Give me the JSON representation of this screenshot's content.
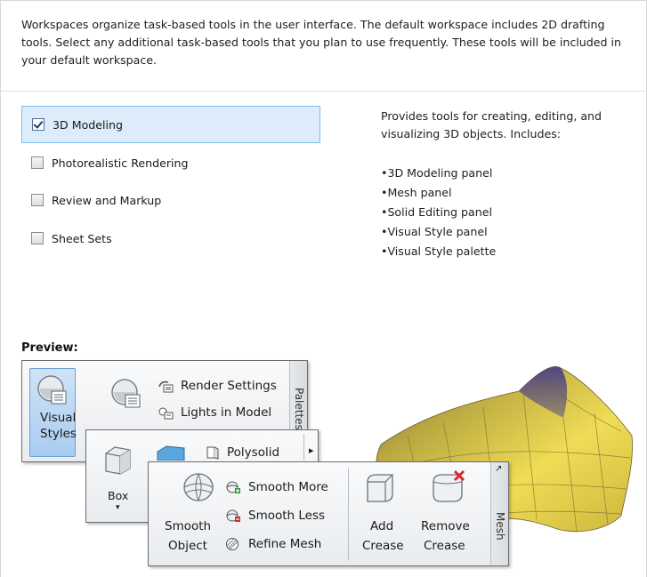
{
  "intro_text": "Workspaces organize task-based tools in the user interface. The default workspace includes 2D drafting tools. Select any additional task-based tools that you plan to use frequently. These tools will be included in your default workspace.",
  "options": [
    {
      "label": "3D Modeling",
      "checked": true
    },
    {
      "label": "Photorealistic Rendering",
      "checked": false
    },
    {
      "label": "Review and Markup",
      "checked": false
    },
    {
      "label": "Sheet Sets",
      "checked": false
    }
  ],
  "description": {
    "text": "Provides tools for creating, editing, and visualizing 3D objects. Includes:",
    "items": [
      "3D Modeling panel",
      "Mesh panel",
      "Solid Editing panel",
      "Visual Style panel",
      "Visual Style palette"
    ]
  },
  "preview": {
    "label": "Preview:",
    "palettes_panel": {
      "visual_styles_line1": "Visual",
      "visual_styles_line2": "Styles",
      "render_settings": "Render Settings",
      "lights_in_model": "Lights in Model",
      "title": "Palettes"
    },
    "modeling_panel": {
      "box": "Box",
      "box_arrow": "▾",
      "polysolid": "Polysolid",
      "expand": "▸"
    },
    "mesh_panel": {
      "smooth_object_line1": "Smooth",
      "smooth_object_line2": "Object",
      "smooth_more": "Smooth More",
      "smooth_less": "Smooth Less",
      "refine_mesh": "Refine Mesh",
      "add_crease_line1": "Add",
      "add_crease_line2": "Crease",
      "remove_crease_line1": "Remove",
      "remove_crease_line2": "Crease",
      "title": "Mesh",
      "launcher": "↗"
    }
  },
  "colors": {
    "selection_bg": "#dcecfb",
    "selection_border": "#7fbbec",
    "mesh_yellow": "#e8d44a",
    "mesh_purple": "#4a3d8f"
  }
}
